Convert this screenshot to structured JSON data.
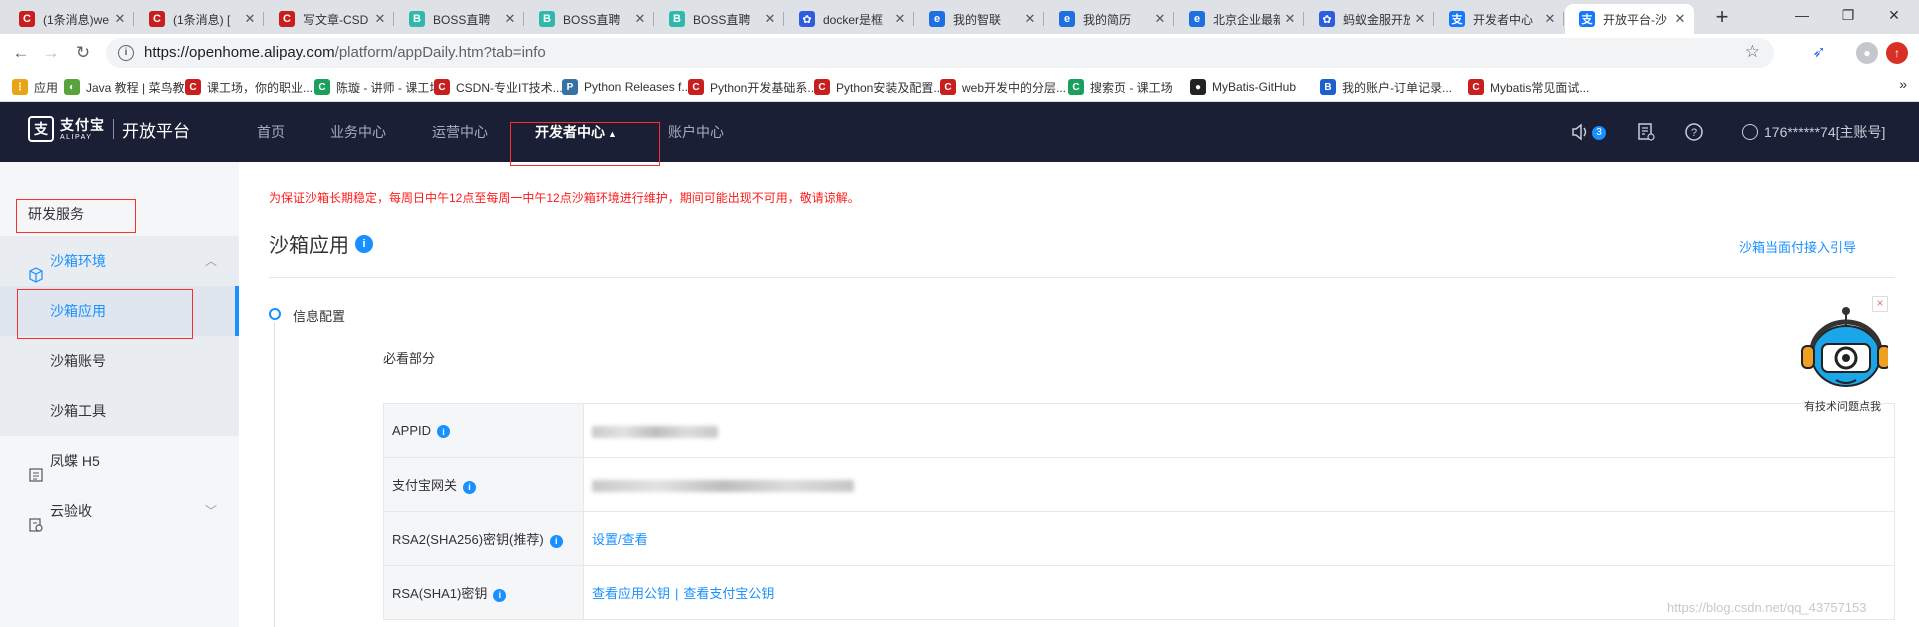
{
  "browser": {
    "tabs": [
      {
        "title": "(1条消息)we",
        "color": "#c81e1e",
        "glyph": "C"
      },
      {
        "title": "(1条消息) [",
        "color": "#c81e1e",
        "glyph": "C"
      },
      {
        "title": "写文章-CSD",
        "color": "#c81e1e",
        "glyph": "C"
      },
      {
        "title": "BOSS直聘",
        "color": "#2fb8ab",
        "glyph": "B"
      },
      {
        "title": "BOSS直聘",
        "color": "#2fb8ab",
        "glyph": "B"
      },
      {
        "title": "BOSS直聘",
        "color": "#2fb8ab",
        "glyph": "B"
      },
      {
        "title": "docker是框",
        "color": "#2e5de0",
        "glyph": "✿"
      },
      {
        "title": "我的智联",
        "color": "#1e6fe0",
        "glyph": "e"
      },
      {
        "title": "我的简历",
        "color": "#1e6fe0",
        "glyph": "e"
      },
      {
        "title": "北京企业最新",
        "color": "#1e6fe0",
        "glyph": "e"
      },
      {
        "title": "蚂蚁金服开放",
        "color": "#2e5de0",
        "glyph": "✿"
      },
      {
        "title": "开发者中心",
        "color": "#1677ff",
        "glyph": "支"
      },
      {
        "title": "开放平台-沙",
        "color": "#1677ff",
        "glyph": "支"
      }
    ],
    "new_tab": "+",
    "window_controls": [
      "—",
      "❐",
      "✕"
    ],
    "url_host": "https://openhome.alipay.com",
    "url_path": "/platform/appDaily.htm?tab=info",
    "bookmarks": [
      {
        "label": "应用",
        "color": "#e8a317",
        "glyph": "⋮"
      },
      {
        "label": "Java 教程 | 菜鸟教程",
        "color": "#5aa33c",
        "glyph": "◐"
      },
      {
        "label": "课工场，你的职业...",
        "color": "#c81e1e",
        "glyph": "C"
      },
      {
        "label": "陈璇 - 讲师 - 课工场",
        "color": "#1a9f5d",
        "glyph": "C"
      },
      {
        "label": "CSDN-专业IT技术...",
        "color": "#c81e1e",
        "glyph": "C"
      },
      {
        "label": "Python Releases f...",
        "color": "#3572a5",
        "glyph": "P"
      },
      {
        "label": "Python开发基础系...",
        "color": "#c81e1e",
        "glyph": "C"
      },
      {
        "label": "Python安装及配置...",
        "color": "#c81e1e",
        "glyph": "C"
      },
      {
        "label": "web开发中的分层...",
        "color": "#c81e1e",
        "glyph": "C"
      },
      {
        "label": "搜索页 - 课工场",
        "color": "#1a9f5d",
        "glyph": "C"
      },
      {
        "label": "MyBatis-GitHub",
        "color": "#222222",
        "glyph": "●"
      },
      {
        "label": "我的账户-订单记录...",
        "color": "#1e5fd0",
        "glyph": "B"
      },
      {
        "label": "Mybatis常见面试...",
        "color": "#c81e1e",
        "glyph": "C"
      }
    ],
    "bookmarks_more": "»"
  },
  "header": {
    "logo_cn": "支付宝",
    "logo_en": "ALIPAY",
    "platform": "开放平台",
    "nav": [
      "首页",
      "业务中心",
      "运营中心",
      "开发者中心",
      "账户中心"
    ],
    "nav_active": "开发者中心",
    "notification_count": "3",
    "account": "176******74[主账号]"
  },
  "sidebar": {
    "section": "研发服务",
    "group_sandbox": "沙箱环境",
    "sandbox_items": [
      "沙箱应用",
      "沙箱账号",
      "沙箱工具"
    ],
    "fengdie": "凤蝶 H5",
    "cloud_accept": "云验收"
  },
  "main": {
    "notice": "为保证沙箱长期稳定，每周日中午12点至每周一中午12点沙箱环境进行维护，期间可能出现不可用，敬请谅解。",
    "title": "沙箱应用",
    "guide_link": "沙箱当面付接入引导",
    "step_label": "信息配置",
    "must_read": "必看部分",
    "rows": {
      "appid": "APPID",
      "gateway": "支付宝网关",
      "rsa2": "RSA2(SHA256)密钥(推荐)",
      "rsa2_action": "设置/查看",
      "rsa": "RSA(SHA1)密钥",
      "rsa_view_app_key": "查看应用公钥",
      "rsa_sep": "|",
      "rsa_view_alipay_key": "查看支付宝公钥"
    }
  },
  "helper": {
    "label": "有技术问题点我",
    "close": "×"
  },
  "watermark": "https://blog.csdn.net/qq_43757153",
  "colors": {
    "accent": "#1890ff",
    "header_bg": "#1a1f36",
    "alert": "#ff1a1a"
  }
}
